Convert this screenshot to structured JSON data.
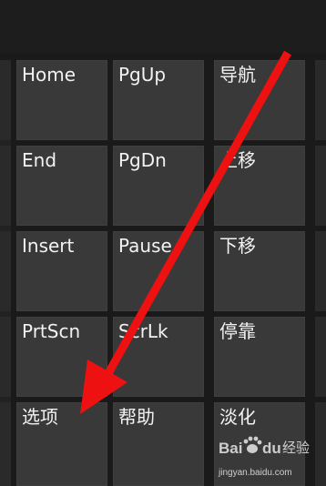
{
  "keyboard": {
    "keys": [
      {
        "label": "Home"
      },
      {
        "label": "PgUp"
      },
      {
        "label": "导航"
      },
      {
        "label": "End"
      },
      {
        "label": "PgDn"
      },
      {
        "label": "上移"
      },
      {
        "label": "Insert"
      },
      {
        "label": "Pause"
      },
      {
        "label": "下移"
      },
      {
        "label": "PrtScn"
      },
      {
        "label": "ScrLk"
      },
      {
        "label": "停靠"
      },
      {
        "label": "选项"
      },
      {
        "label": "帮助"
      },
      {
        "label": "淡化"
      }
    ]
  },
  "colors": {
    "background": "#1a1a1a",
    "key_fill": "#393939",
    "key_text": "#f2f2f2",
    "annotation_arrow": "#ee1111"
  },
  "watermark": {
    "brand": "Baidu经验",
    "url": "jingyan.baidu.com"
  }
}
